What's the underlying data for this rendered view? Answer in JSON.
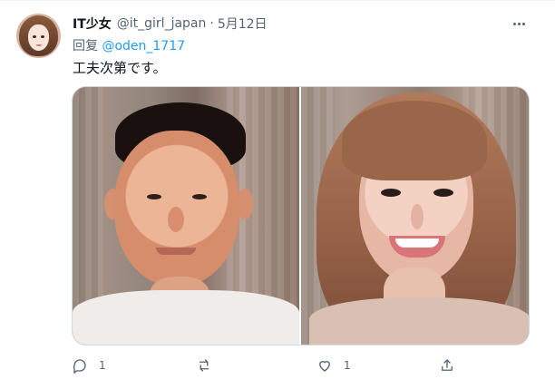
{
  "tweet": {
    "display_name": "IT少女",
    "handle": "@it_girl_japan",
    "date": "5月12日",
    "reply_prefix": "回复",
    "reply_to": "@oden_1717",
    "text": "工夫次第です。"
  },
  "actions": {
    "reply_count": "1",
    "like_count": "1"
  },
  "icons": {
    "more": "more-horizontal-icon",
    "reply": "reply-icon",
    "retweet": "retweet-icon",
    "like": "heart-icon",
    "share": "share-icon"
  },
  "colors": {
    "text": "#0f1419",
    "muted": "#536471",
    "accent": "#1d9bf0",
    "border": "#cfd9de"
  }
}
